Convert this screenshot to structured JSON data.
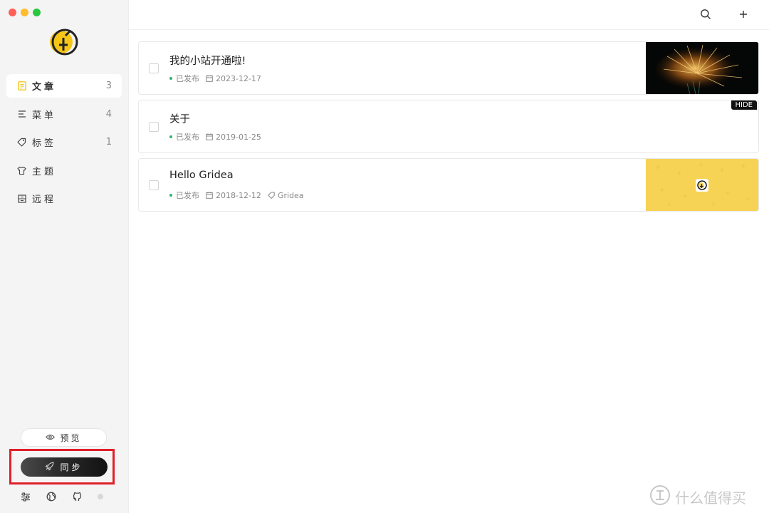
{
  "sidebar": {
    "items": [
      {
        "label": "文章",
        "count": "3",
        "icon": "document-icon",
        "active": true
      },
      {
        "label": "菜单",
        "count": "4",
        "icon": "menu-lines-icon",
        "active": false
      },
      {
        "label": "标签",
        "count": "1",
        "icon": "tag-icon",
        "active": false
      },
      {
        "label": "主题",
        "count": "",
        "icon": "shirt-icon",
        "active": false
      },
      {
        "label": "远程",
        "count": "",
        "icon": "server-icon",
        "active": false
      }
    ],
    "preview_label": "预览",
    "sync_label": "同步",
    "accent_color": "#f5c518"
  },
  "topbar": {
    "search_icon": "search-icon",
    "add_icon": "plus-icon"
  },
  "posts": [
    {
      "title": "我的小站开通啦!",
      "status": "已发布",
      "date": "2023-12-17",
      "tag": "",
      "thumbnail": "fireworks",
      "hidden": false
    },
    {
      "title": "关于",
      "status": "已发布",
      "date": "2019-01-25",
      "tag": "",
      "thumbnail": "",
      "hidden": true,
      "hidden_badge": "HIDE"
    },
    {
      "title": "Hello Gridea",
      "status": "已发布",
      "date": "2018-12-12",
      "tag": "Gridea",
      "thumbnail": "gridea-yellow",
      "hidden": false
    }
  ],
  "watermark": {
    "text": "什么值得买"
  }
}
